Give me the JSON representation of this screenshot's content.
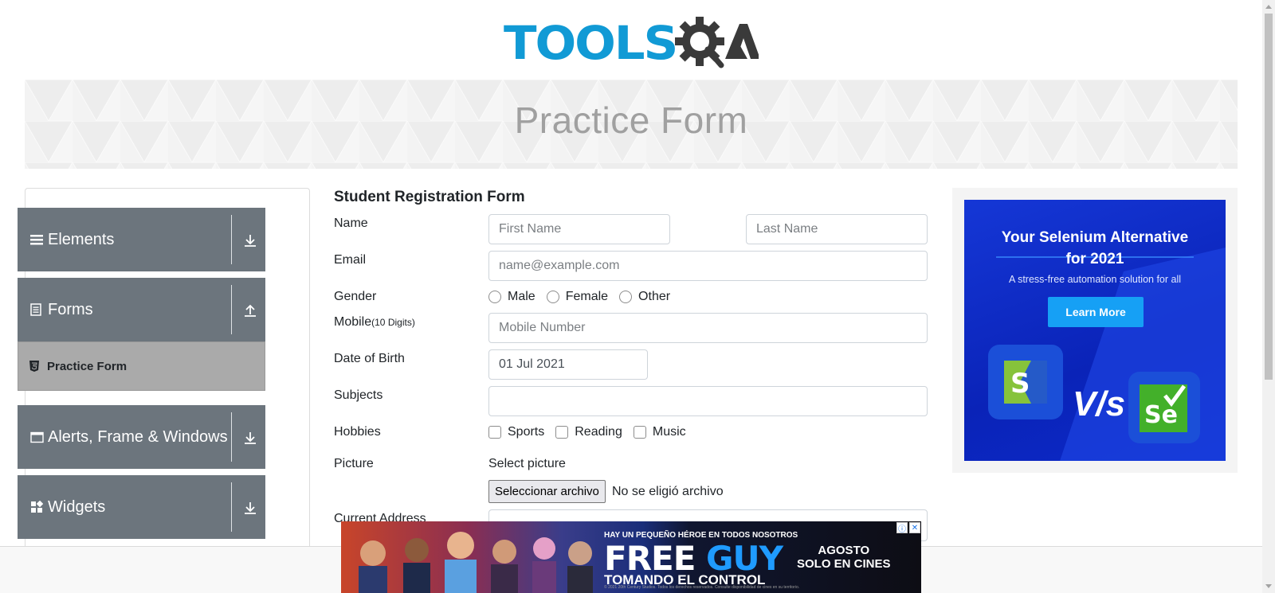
{
  "header": {
    "logo_text": "TOOLS",
    "logo_suffix": "QA"
  },
  "banner": {
    "title": "Practice Form"
  },
  "sidebar": {
    "groups": [
      {
        "label": "Elements",
        "icon": "menu-icon",
        "arrow": "download-icon"
      },
      {
        "label": "Forms",
        "icon": "document-icon",
        "arrow": "upload-icon"
      },
      {
        "label": "Alerts, Frame & Windows",
        "icon": "window-icon",
        "arrow": "download-icon"
      },
      {
        "label": "Widgets",
        "icon": "widgets-icon",
        "arrow": "download-icon"
      }
    ],
    "active_item": {
      "label": "Practice Form",
      "icon": "html5-icon"
    }
  },
  "form": {
    "title": "Student Registration Form",
    "labels": {
      "name": "Name",
      "email": "Email",
      "gender": "Gender",
      "mobile": "Mobile",
      "mobile_hint": "(10 Digits)",
      "dob": "Date of Birth",
      "subjects": "Subjects",
      "hobbies": "Hobbies",
      "picture": "Picture",
      "current_address": "Current Address"
    },
    "first_name_placeholder": "First Name",
    "last_name_placeholder": "Last Name",
    "email_placeholder": "name@example.com",
    "mobile_placeholder": "Mobile Number",
    "dob_value": "01 Jul 2021",
    "subjects_value": "",
    "gender_options": [
      "Male",
      "Female",
      "Other"
    ],
    "hobby_options": [
      "Sports",
      "Reading",
      "Music"
    ],
    "picture_label": "Select picture",
    "file_button": "Seleccionar archivo",
    "file_status": "No se eligió archivo"
  },
  "right_ad": {
    "title_line1": "Your Selenium Alternative",
    "title_line2": "for 2021",
    "subtitle": "A stress-free automation solution for all",
    "button": "Learn More",
    "vs_text": "V/s",
    "left_logo_letter": "S",
    "right_logo_text": "Se"
  },
  "bottom_ad": {
    "tagline": "HAY UN PEQUEÑO HÉROE EN TODOS NOSOTROS",
    "title_free": "FREE",
    "title_guy": "GUY",
    "subtitle": "TOMANDO EL CONTROL",
    "side_line1": "AGOSTO",
    "side_line2": "SOLO EN CINES",
    "legal": "© 2021 20th Century Studios. Todos los derechos reservados. Consulte disponibilidad de cines en su territorio."
  },
  "colors": {
    "brand_blue": "#119ad5",
    "sidebar_gray": "#6c757d",
    "active_item": "#aaaaaa",
    "ad_blue": "#1537d6"
  }
}
